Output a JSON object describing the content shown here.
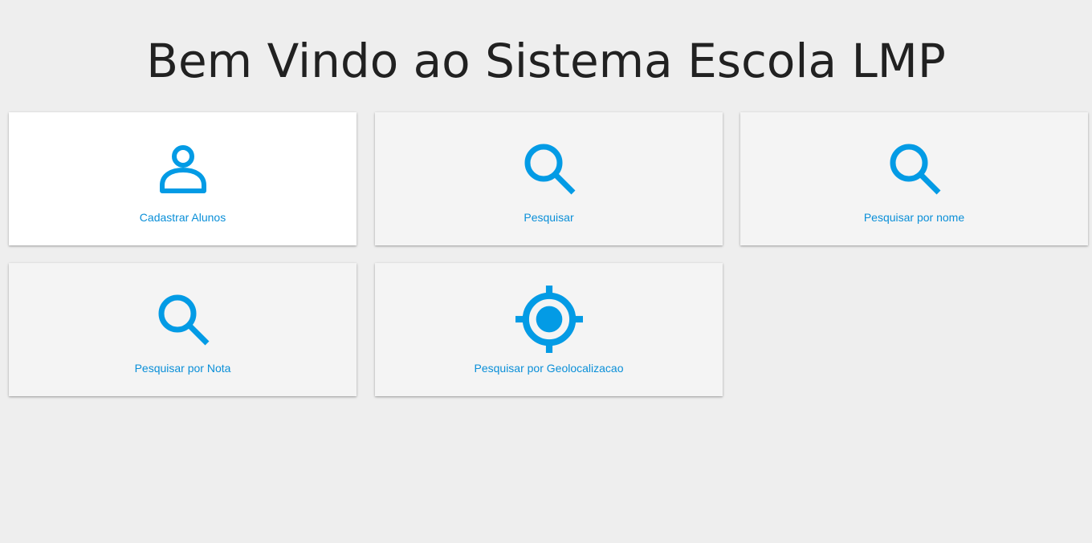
{
  "header": {
    "title": "Bem Vindo ao Sistema Escola LMP"
  },
  "theme": {
    "accent": "#039be5",
    "label_color": "#0a8fd8",
    "background": "#eeeeee",
    "card_background": "#f4f4f4",
    "card_active_background": "#ffffff"
  },
  "menu": {
    "cards": [
      {
        "label": "Cadastrar Alunos",
        "icon": "person-icon"
      },
      {
        "label": "Pesquisar",
        "icon": "search-icon"
      },
      {
        "label": "Pesquisar por nome",
        "icon": "search-icon"
      },
      {
        "label": "Pesquisar por Nota",
        "icon": "search-icon"
      },
      {
        "label": "Pesquisar por Geolocalizacao",
        "icon": "gps-target-icon"
      }
    ]
  }
}
